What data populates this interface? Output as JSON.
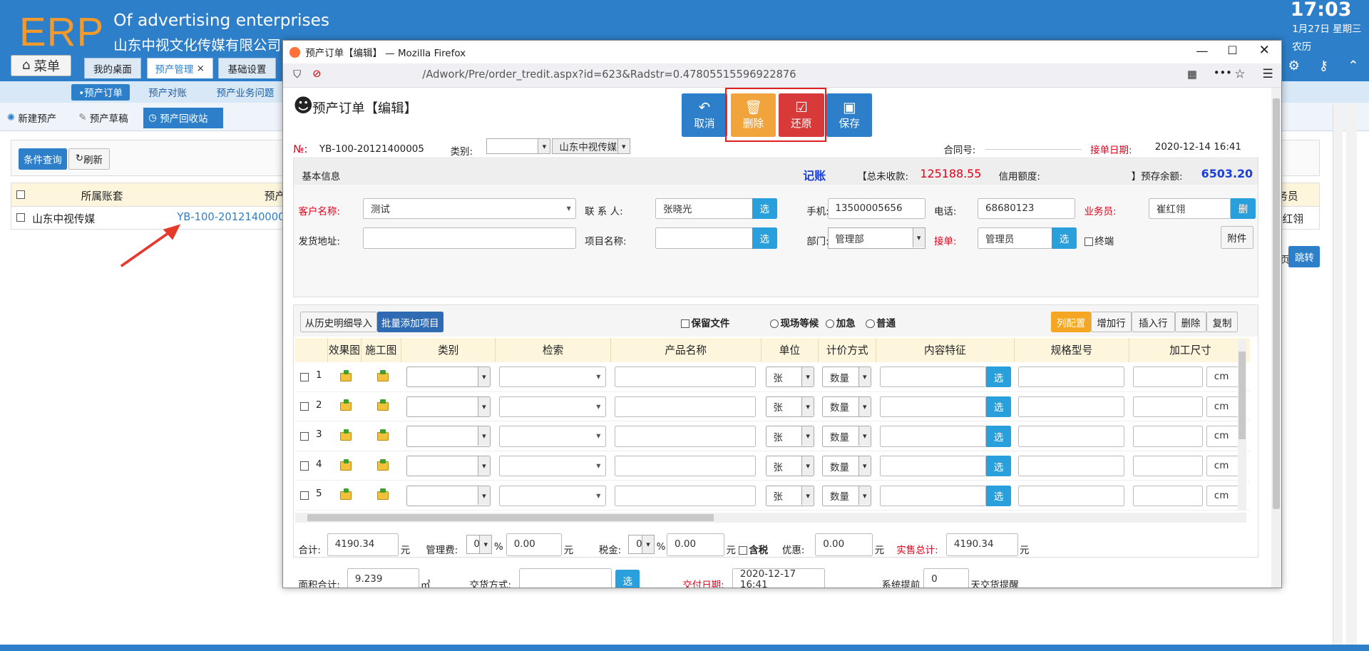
{
  "header": {
    "logo": "ERP",
    "caption_en": "Of advertising enterprises",
    "caption_cn": "山东中视文化传媒有限公司",
    "time": "17:03",
    "date": "1月27日 星期三",
    "lunar": "农历",
    "menu_label": "菜单"
  },
  "tabs": [
    {
      "label": "我的桌面"
    },
    {
      "label": "预产管理",
      "close": "×"
    },
    {
      "label": "基础设置"
    }
  ],
  "subnav": [
    "•预产订单",
    "预产对账",
    "预产业务问题"
  ],
  "toolbar": [
    "新建预产",
    "预产草稿",
    "预产回收站"
  ],
  "list": {
    "query_label": "条件查询",
    "refresh_label": "刷新",
    "col_account": "所属账套",
    "col_order": "预产",
    "col_staff": "务员",
    "row_account": "山东中视传媒",
    "row_order": "YB-100-20121400005",
    "row_staff": "红翎",
    "goto_label": "跳转",
    "page_hint": "页"
  },
  "window": {
    "title": "预产订单【编辑】 — Mozilla Firefox",
    "url": "/Adwork/Pre/order_tredit.aspx?id=623&Radstr=0.47805515596922876"
  },
  "form": {
    "title": "预产订单【编辑】",
    "actions": {
      "cancel": "取消",
      "delete": "删除",
      "restore": "还原",
      "save": "保存"
    },
    "order_no_label": "№:",
    "order_no": "YB-100-20121400005",
    "category_label": "类别:",
    "company": "山东中视传媒",
    "contract_label": "合同号:",
    "receive_date_label": "接单日期:",
    "receive_date": "2020-12-14 16:41",
    "basic_info": "基本信息",
    "bookkeeping": "记账",
    "total_uncollected_label": "【总未收款:",
    "total_uncollected": "125188.55",
    "credit_label": "信用额度:",
    "prepaid_label": "】预存余额:",
    "prepaid": "6503.20",
    "customer_label": "客户名称:",
    "customer": "测试",
    "contact_label": "联 系 人:",
    "contact": "张晓光",
    "select": "选",
    "mobile_label": "手机:",
    "mobile": "13500005656",
    "phone_label": "电话:",
    "phone": "68680123",
    "salesman_label": "业务员:",
    "salesman": "崔红翎",
    "delete_short": "删",
    "address_label": "发货地址:",
    "project_label": "项目名称:",
    "dept_label": "部门:",
    "dept": "管理部",
    "receiver_label": "接单:",
    "receiver": "管理员",
    "terminal_label": "终端",
    "attachment": "附件"
  },
  "items": {
    "import_history": "从历史明细导入",
    "batch_add": "批量添加项目",
    "keep_file": "保留文件",
    "wait_onsite": "现场等候",
    "urgent": "加急",
    "normal": "普通",
    "btn_colconfig": "列配置",
    "btn_addrow": "增加行",
    "btn_insertrow": "插入行",
    "btn_delete": "删除",
    "btn_copy": "复制",
    "columns": [
      "效果图",
      "施工图",
      "类别",
      "检索",
      "产品名称",
      "单位",
      "计价方式",
      "内容特征",
      "规格型号",
      "加工尺寸"
    ],
    "rows": [
      {
        "n": "1"
      },
      {
        "n": "2"
      },
      {
        "n": "3"
      },
      {
        "n": "4"
      },
      {
        "n": "5"
      }
    ],
    "unit": "张",
    "pricing": "数量",
    "cm": "cm"
  },
  "totals": {
    "sum_label": "合计:",
    "sum": "4190.34",
    "yuan": "元",
    "mgmt_label": "管理费:",
    "mgmt_pct": "0",
    "pct": "%",
    "mgmt_val": "0.00",
    "tax_label": "税金:",
    "tax_pct": "0",
    "tax_val": "0.00",
    "tax_incl": "含税",
    "discount_label": "优惠:",
    "discount": "0.00",
    "actual_label": "实售总计:",
    "actual": "4190.34",
    "area_label": "面积合计:",
    "area": "9.239",
    "area_unit": "㎡",
    "delivery_method_label": "交货方式:",
    "delivery_date_label": "交付日期:",
    "delivery_date": "2020-12-17 16:41",
    "remind_label": "系统提前",
    "remind_days": "0",
    "remind_suffix": "天交货提醒"
  }
}
